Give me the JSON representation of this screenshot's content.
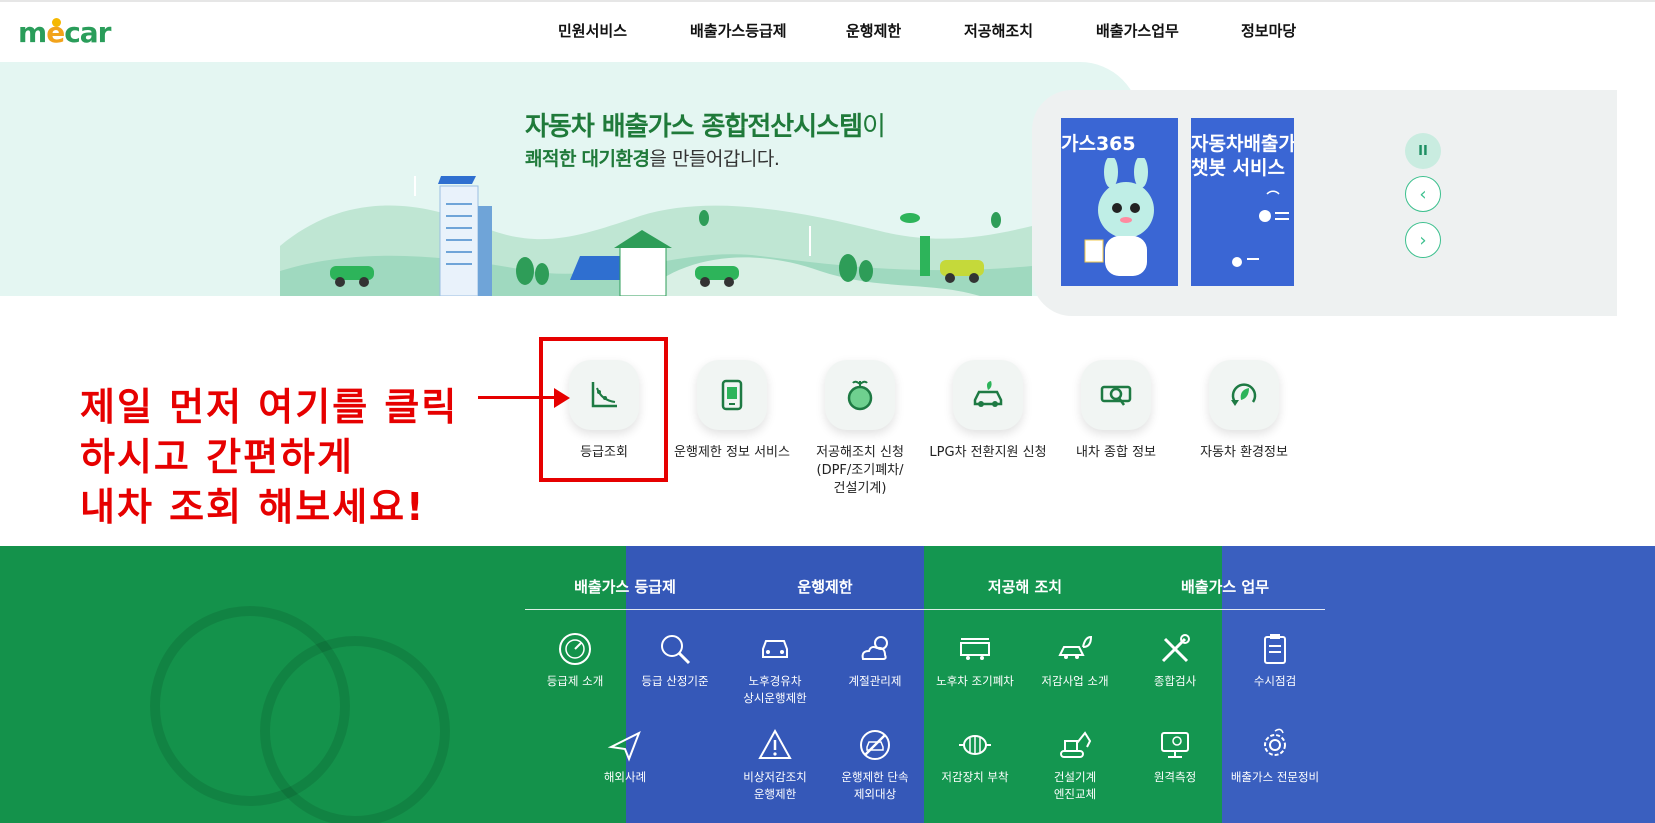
{
  "logo": {
    "text_m": "m",
    "text_e": "e",
    "text_rest": "car"
  },
  "gnb": [
    "민원서비스",
    "배출가스등급제",
    "운행제한",
    "저공해조치",
    "배출가스업무",
    "정보마당"
  ],
  "hero": {
    "title": "자동차 배출가스 종합전산시스템",
    "title_tail": "이",
    "sub_bold1": "쾌적한",
    "sub_bold2": "대기환경",
    "sub_tail": "을 만들어갑니다."
  },
  "slider": {
    "card1_text": "가스365",
    "card2_line1": "자동차배출가",
    "card2_line2": "챗봇 서비스",
    "pause_label": "II",
    "prev_label": "‹",
    "next_label": "›"
  },
  "quick_menu": [
    {
      "label": "등급조회",
      "icon": "chart-icon"
    },
    {
      "label": "운행제한 정보 서비스",
      "icon": "tablet-icon"
    },
    {
      "label": "저공해조치 신청\n(DPF/조기폐차/\n건설기계)",
      "icon": "earth-sprout-icon"
    },
    {
      "label": "LPG차 전환지원 신청",
      "icon": "eco-car-icon"
    },
    {
      "label": "내차 종합 정보",
      "icon": "magnifier-card-icon"
    },
    {
      "label": "자동차 환경정보",
      "icon": "recycle-leaf-icon"
    }
  ],
  "callout": {
    "line1": "제일 먼저 여기를 클릭",
    "line2": "하시고 간편하게",
    "line3": "내차 조회 해보세요!"
  },
  "categories": [
    "배출가스 등급제",
    "운행제한",
    "저공해 조치",
    "배출가스 업무"
  ],
  "bottom_menu_row1": [
    {
      "label": "등급제 소개",
      "icon": "gauge-icon"
    },
    {
      "label": "등급 산정기준",
      "icon": "magnifier-icon"
    },
    {
      "label": "노후경유차\n상시운행제한",
      "icon": "car-front-icon"
    },
    {
      "label": "계절관리제",
      "icon": "cloud-sun-icon"
    },
    {
      "label": "노후차 조기폐차",
      "icon": "crushed-car-icon"
    },
    {
      "label": "저감사업 소개",
      "icon": "leaf-car-icon"
    },
    {
      "label": "종합검사",
      "icon": "tools-icon"
    },
    {
      "label": "수시점검",
      "icon": "clipboard-icon"
    }
  ],
  "bottom_menu_row2": [
    {
      "label": "해외사례",
      "icon": "airplane-icon"
    },
    {
      "label": "비상저감조치\n운행제한",
      "icon": "warning-icon"
    },
    {
      "label": "운행제한 단속\n제외대상",
      "icon": "no-car-icon"
    },
    {
      "label": "저감장치 부착",
      "icon": "filter-device-icon"
    },
    {
      "label": "건설기계\n엔진교체",
      "icon": "excavator-icon"
    },
    {
      "label": "원격측정",
      "icon": "monitor-icon"
    },
    {
      "label": "배출가스 전문정비",
      "icon": "gear-leaf-icon"
    }
  ],
  "colors": {
    "brand_green": "#1f7a3a",
    "hero_bg": "#e4f6f2",
    "callout_red": "#e60000",
    "bottom_green": "#14924b",
    "bottom_blue": "#3558b8",
    "slider_accent": "#3cc08e"
  }
}
